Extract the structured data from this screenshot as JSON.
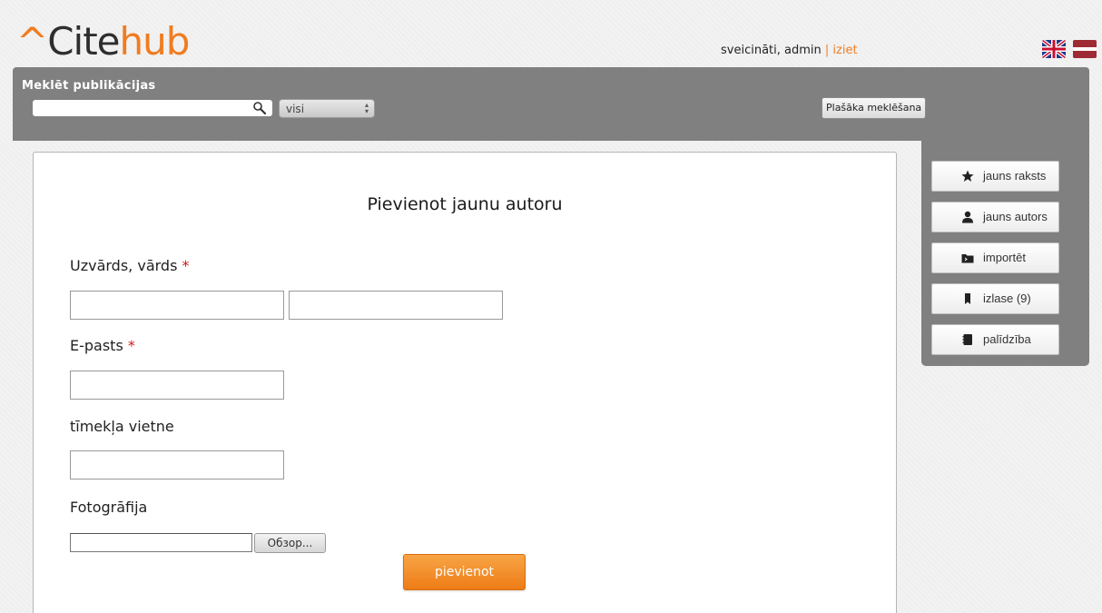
{
  "brand": {
    "caret": "^",
    "part1": "Cite",
    "part2": "hub",
    "accent_color": "#f07c20"
  },
  "user": {
    "greeting": "sveicināti, admin",
    "separator": "|",
    "logout_label": "iziet"
  },
  "languages": [
    {
      "name": "uk-flag-icon"
    },
    {
      "name": "lv-flag-icon"
    }
  ],
  "search": {
    "title": "Meklēt publikācijas",
    "value": "",
    "scope_value": "visi",
    "advanced_label": "Plašāka meklēšana"
  },
  "sidebar": {
    "items": [
      {
        "label": "jauns raksts",
        "icon": "star-icon"
      },
      {
        "label": "jauns autors",
        "icon": "user-icon"
      },
      {
        "label": "importēt",
        "icon": "folder-icon"
      },
      {
        "label": "izlase (9)",
        "icon": "bookmark-icon"
      },
      {
        "label": "palīdzība",
        "icon": "book-icon"
      }
    ]
  },
  "form": {
    "title": "Pievienot jaunu autoru",
    "name_label": "Uzvārds, vārds",
    "email_label": "E-pasts",
    "website_label": "tīmekļa vietne",
    "photo_label": "Fotogrāfija",
    "required_marker": "*",
    "browse_label": "Обзор...",
    "submit_label": "pievienot"
  }
}
